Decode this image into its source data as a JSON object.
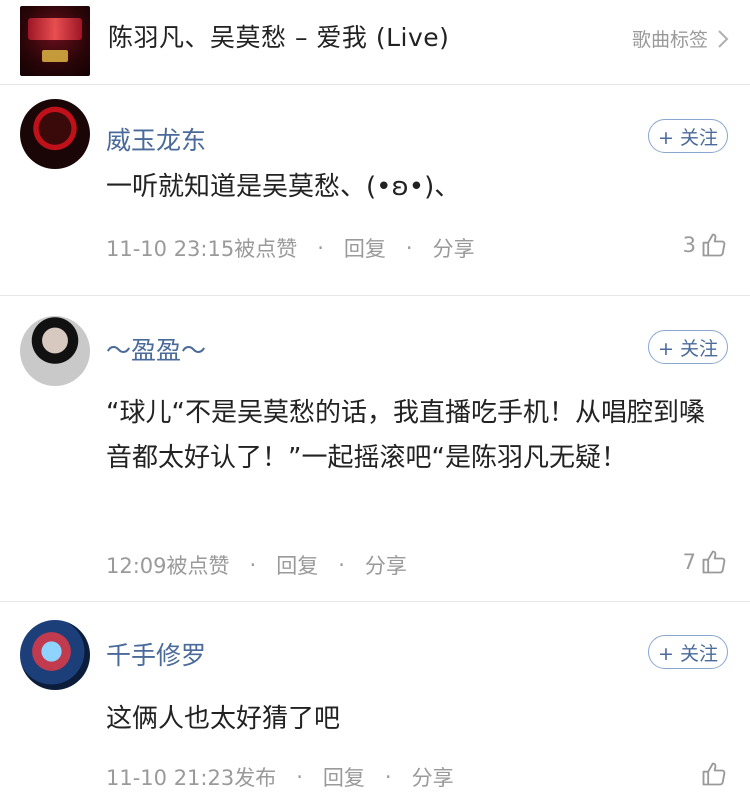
{
  "header": {
    "cover_alt": "album-cover",
    "song_title": "陈羽凡、吴莫愁 – 爱我 (Live)",
    "tags_link": "歌曲标签"
  },
  "comments": [
    {
      "username": "威玉龙东",
      "follow": "+ 关注",
      "text": "一听就知道是吴莫愁、(•ʚ•)、",
      "time": "11-10 23:15被点赞",
      "reply": "回复",
      "share": "分享",
      "likes": "3"
    },
    {
      "username": "～盈盈～",
      "follow": "+ 关注",
      "text": "“球儿“不是吴莫愁的话，我直播吃手机！从唱腔到嗓音都太好认了！”一起摇滚吧“是陈羽凡无疑！",
      "time": "12:09被点赞",
      "reply": "回复",
      "share": "分享",
      "likes": "7"
    },
    {
      "username": "千手修罗",
      "follow": "+ 关注",
      "text": "这俩人也太好猜了吧",
      "time": "11-10 21:23发布",
      "reply": "回复",
      "share": "分享",
      "likes": ""
    }
  ],
  "colors": {
    "username": "#4a6a9a",
    "meta": "#9a9a9a",
    "follow_border": "#8aa7d0",
    "divider": "#e6e6e6"
  },
  "icons": {
    "chevron": "chevron-right-icon",
    "like": "thumb-up-icon",
    "separator": "·"
  }
}
